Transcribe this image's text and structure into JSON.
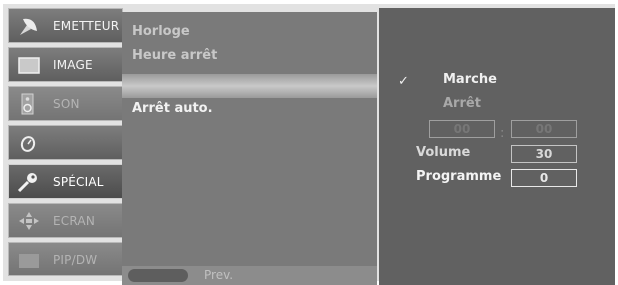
{
  "sidebar": {
    "items": [
      {
        "label": "EMETTEUR",
        "icon": "satellite-dish-icon",
        "state": "normal"
      },
      {
        "label": "IMAGE",
        "icon": "picture-icon",
        "state": "normal"
      },
      {
        "label": "SON",
        "icon": "speaker-icon",
        "state": "dim"
      },
      {
        "label": "",
        "icon": "clock-icon",
        "state": "normal"
      },
      {
        "label": "SPÉCIAL",
        "icon": "key-icon",
        "state": "active"
      },
      {
        "label": "ECRAN",
        "icon": "arrows-move-icon",
        "state": "dim"
      },
      {
        "label": "PIP/DW",
        "icon": "pip-icon",
        "state": "dim"
      }
    ]
  },
  "menu": {
    "items": [
      {
        "label": "Horloge"
      },
      {
        "label": "Heure arrêt"
      },
      {
        "label": ""
      },
      {
        "label": "Arrêt auto."
      }
    ],
    "footer": {
      "prev_label": "Prev."
    }
  },
  "submenu": {
    "check_mark": "✓",
    "on_label": "Marche",
    "off_label": "Arrêt",
    "hour_value": "00",
    "separator": ":",
    "minute_value": "00",
    "volume_label": "Volume",
    "volume_value": "30",
    "program_label": "Programme",
    "program_value": "0"
  }
}
